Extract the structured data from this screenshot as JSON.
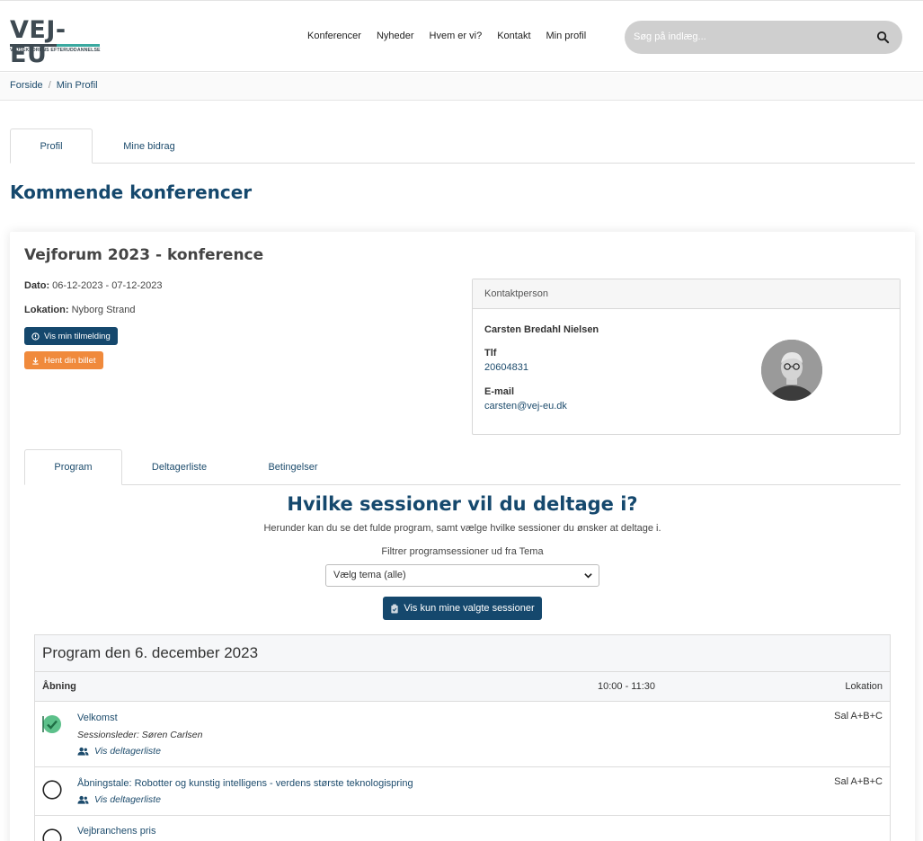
{
  "header": {
    "logo_text": "VEJ-EU",
    "logo_sub": "VEJSEKTORENS EFTERUDDANNELSE",
    "nav": [
      "Konferencer",
      "Nyheder",
      "Hvem er vi?",
      "Kontakt",
      "Min profil"
    ],
    "search_placeholder": "Søg på indlæg..."
  },
  "breadcrumb": {
    "home": "Forside",
    "sep": "/",
    "current": "Min Profil"
  },
  "profile_tabs": {
    "profil": "Profil",
    "bidrag": "Mine bidrag"
  },
  "section_title": "Kommende konferencer",
  "conference": {
    "title": "Vejforum 2023 - konference",
    "date_label": "Dato:",
    "date_value": "06-12-2023 - 07-12-2023",
    "location_label": "Lokation:",
    "location_value": "Nyborg Strand",
    "btn_tilmelding": "Vis min tilmelding",
    "btn_billet": "Hent din billet"
  },
  "contact": {
    "heading": "Kontaktperson",
    "name": "Carsten Bredahl Nielsen",
    "phone_label": "Tlf",
    "phone": "20604831",
    "email_label": "E-mail",
    "email": "carsten@vej-eu.dk"
  },
  "conf_tabs": {
    "program": "Program",
    "deltagere": "Deltagerliste",
    "betingelser": "Betingelser"
  },
  "sessions": {
    "heading": "Hvilke sessioner vil du deltage i?",
    "sub": "Herunder kan du se det fulde program, samt vælge hvilke sessioner du ønsker at deltage i.",
    "filter_label": "Filtrer programsessioner ud fra Tema",
    "filter_value": "Vælg tema (alle)",
    "btn_mine": "Vis kun mine valgte sessioner"
  },
  "program": {
    "day_title": "Program den 6. december 2023",
    "block_name": "Åbning",
    "block_time": "10:00 - 11:30",
    "block_loc_header": "Lokation",
    "rows": [
      {
        "title": "Velkomst",
        "leader": "Sessionsleder: Søren Carlsen",
        "deltag": "Vis deltagerliste",
        "loc": "Sal A+B+C",
        "selected": true
      },
      {
        "title": "Åbningstale: Robotter og kunstig intelligens - verdens største teknologispring",
        "deltag": "Vis deltagerliste",
        "loc": "Sal A+B+C",
        "selected": false
      },
      {
        "title": "Vejbranchens pris",
        "selected": false
      }
    ]
  },
  "colors": {
    "primary": "#15486d",
    "accent_orange": "#f08a3c",
    "check_green": "#5cc08a"
  }
}
